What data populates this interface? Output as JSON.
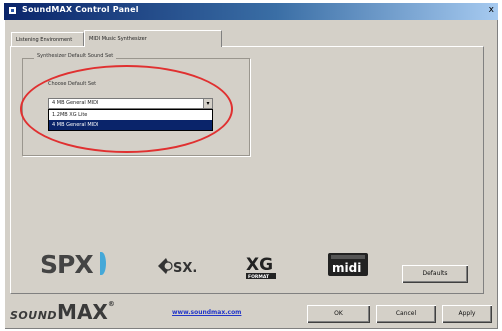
{
  "window": {
    "title": "SoundMAX Control Panel",
    "close_glyph": "x",
    "app_icon": "soundmax-app-icon"
  },
  "tabs": [
    {
      "label": "Listening Environment",
      "selected": false
    },
    {
      "label": "MIDI Music Synthesizer",
      "selected": true
    }
  ],
  "synth_group": {
    "legend": "Synthesizer Default Sound Set",
    "choose_label": "Choose Default Set",
    "selected_value": "4 MB General MIDI",
    "dropdown_arrow": "▾",
    "options": [
      {
        "label": "1.2MB XG Lite",
        "highlighted": false
      },
      {
        "label": "4 MB General MIDI",
        "highlighted": true
      }
    ]
  },
  "annotation": {
    "color": "#e03030"
  },
  "logos": {
    "spx_text": "SPX",
    "sx_text": "SX.",
    "xg_text": "XG",
    "xg_sub": "FORMAT",
    "midi_text": "midi"
  },
  "buttons": {
    "defaults": "Defaults",
    "ok": "OK",
    "cancel": "Cancel",
    "apply": "Apply"
  },
  "footer": {
    "brand_sound": "SOUND",
    "brand_max": "MAX",
    "brand_reg": "®",
    "website": "www.soundmax.com"
  },
  "colors": {
    "titlebar_start": "#0a246a",
    "titlebar_end": "#a6caf0",
    "selection": "#0a246a",
    "spx_wave": "#45a8d8",
    "link": "#2236c8"
  }
}
